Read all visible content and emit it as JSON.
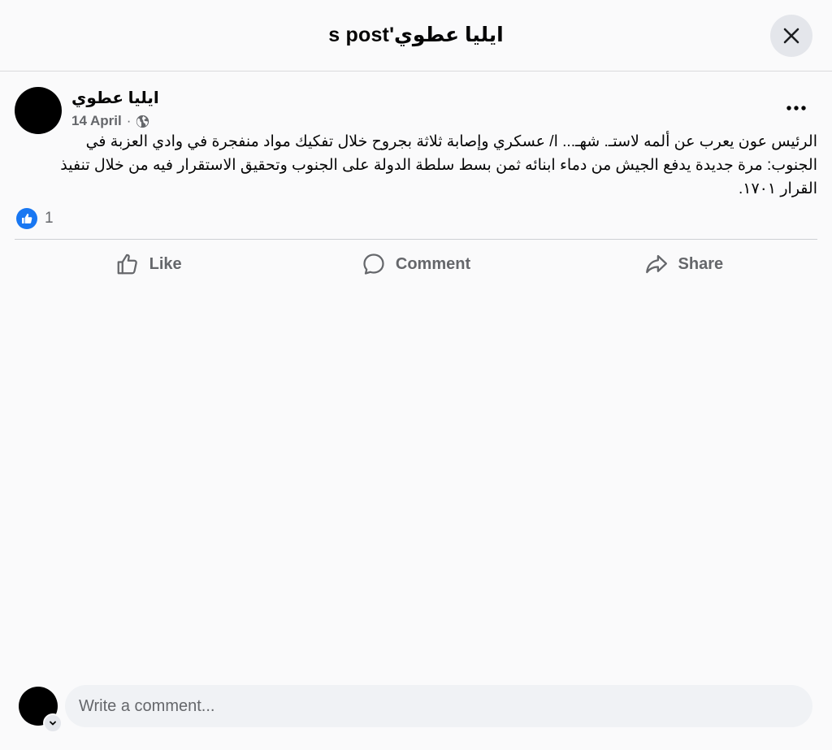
{
  "dialog": {
    "title": "ايليا عطوي's post",
    "close_icon": "close-icon"
  },
  "post": {
    "author": "ايليا عطوي",
    "date": "14 April",
    "separator": "·",
    "privacy_icon": "globe-icon",
    "more_icon": "more-options-icon",
    "text": "الرئيس عون يعرب عن ألمه لاستـ. شهـ... ا/ عسكري وإصابة ثلاثة بجروح خلال تفكيك مواد منفجرة في وادي العزبة في الجنوب: مرة جديدة يدفع الجيش من دماء ابنائه ثمن بسط سلطة الدولة على الجنوب وتحقيق الاستقرار فيه من خلال تنفيذ القرار ١٧٠١.",
    "reactions": {
      "icon": "like-reaction-icon",
      "count": "1"
    }
  },
  "actions": {
    "like": "Like",
    "comment": "Comment",
    "share": "Share"
  },
  "composer": {
    "placeholder": "Write a comment..."
  },
  "colors": {
    "accent": "#1877f2",
    "secondary_text": "#65676b",
    "input_bg": "#f0f2f5",
    "button_bg": "#e4e6eb"
  }
}
